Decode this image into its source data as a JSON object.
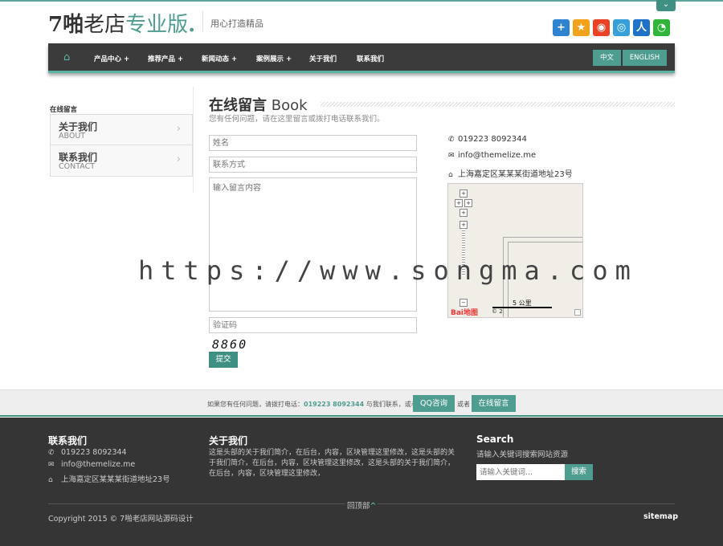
{
  "header": {
    "brand_bold": "7啪",
    "brand_mid": "老店",
    "brand_accent": "专业版",
    "brand_dot": ".",
    "tagline": "用心打造精品",
    "toggle": "⌄",
    "share_icons": [
      "addthis-icon",
      "qzone-icon",
      "weibo-icon",
      "tencent-weibo-icon",
      "renren-icon",
      "wechat-icon"
    ]
  },
  "nav": {
    "items": [
      "产品中心 +",
      "推荐产品 +",
      "新闻动态 +",
      "案例展示 +",
      "关于我们",
      "联系我们"
    ],
    "lang_cn": "中文",
    "lang_en": "ENGLISH"
  },
  "sidebar": {
    "title": "在线留言",
    "items": [
      {
        "cn": "关于我们",
        "en": "ABOUT"
      },
      {
        "cn": "联系我们",
        "en": "CONTACT"
      }
    ]
  },
  "main": {
    "title_cn": "在线留言",
    "title_en": "Book",
    "subtitle": "您有任何问题，请在这里留言或拨打电话联系我们。"
  },
  "form": {
    "name_placeholder": "姓名",
    "contact_placeholder": "联系方式",
    "message_placeholder": "输入留言内容",
    "captcha_placeholder": "验证码",
    "captcha_code": "8860",
    "submit": "提交"
  },
  "contact": {
    "phone": "019223 8092344",
    "email": "info@themelize.me",
    "address": "上海嘉定区某某某街道地址23号"
  },
  "map": {
    "scale": "5 公里",
    "logo": "Bai地图",
    "copyright": "© 2"
  },
  "watermark": "https://www.songma.com",
  "cta": {
    "text_before": "如果您有任何问题，请拨打电话：",
    "phone": "019223 8092344",
    "text_after": "与我们联系，或者",
    "qq_button": "QQ咨询",
    "or_text": "或者",
    "message_button": "在线留言"
  },
  "footer": {
    "contact_title": "联系我们",
    "phone": "019223 8092344",
    "email": "info@themelize.me",
    "address": "上海嘉定区某某某街道地址23号",
    "about_title": "关于我们",
    "about_text": "这是头部的关于我们简介，在后台，内容，区块管理这里修改，这是头部的关于我们简介，在后台，内容，区块管理这里修改，这是头部的关于我们简介，在后台，内容，区块管理这里修改，",
    "search_title": "Search",
    "search_desc": "请输入关键词搜索网站资源",
    "search_placeholder": "请输入关键词...",
    "search_button": "搜索",
    "back_to_top": "回顶部",
    "copyright": "Copyright 2015 © 7啪老店网站源码设计",
    "sitemap": "sitemap"
  }
}
